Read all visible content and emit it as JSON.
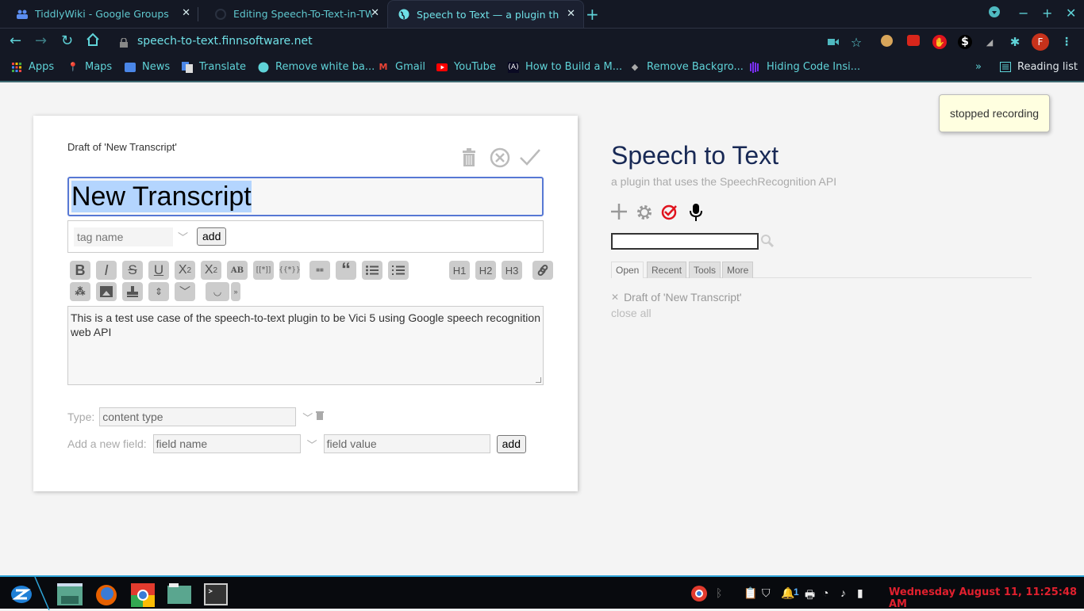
{
  "browser": {
    "tabs": [
      {
        "label": "TiddlyWiki - Google Groups",
        "icon": "google-groups-icon",
        "active": false
      },
      {
        "label": "Editing Speech-To-Text-in-TW",
        "icon": "github-icon",
        "active": false
      },
      {
        "label": "Speech to Text — a plugin tha",
        "icon": "globe-icon",
        "active": true
      }
    ],
    "url": "speech-to-text.finnsoftware.net",
    "profile_initial": "F",
    "reading_list_label": "Reading list",
    "bookmarks": [
      {
        "label": "Apps",
        "icon": "apps-grid-icon"
      },
      {
        "label": "Maps",
        "icon": "maps-pin-icon"
      },
      {
        "label": "News",
        "icon": "news-icon"
      },
      {
        "label": "Translate",
        "icon": "translate-icon"
      },
      {
        "label": "Remove white ba...",
        "icon": "globe-icon"
      },
      {
        "label": "Gmail",
        "icon": "gmail-icon"
      },
      {
        "label": "YouTube",
        "icon": "youtube-icon"
      },
      {
        "label": "How to Build a M...",
        "icon": "freecodecamp-icon"
      },
      {
        "label": "Remove Backgro...",
        "icon": "layers-icon"
      },
      {
        "label": "Hiding Code Insi...",
        "icon": "bars-icon"
      }
    ]
  },
  "editor": {
    "draft_heading": "Draft of 'New Transcript'",
    "title_value": "New Transcript",
    "tag_placeholder": "tag name",
    "add_label": "add",
    "toolbar": [
      "bold",
      "italic",
      "strikethrough",
      "underline",
      "superscript",
      "subscript",
      "smallcaps",
      "wikilink",
      "transclude",
      "monospaced",
      "quote",
      "bulleted-list",
      "numbered-list",
      "heading-1",
      "heading-2",
      "heading-3",
      "link",
      "excise",
      "picture",
      "stamp",
      "size",
      "more",
      "preview",
      "preview-type"
    ],
    "toolbar_labels": {
      "h1": "H1",
      "h2": "H2",
      "h3": "H3",
      "sup": "X",
      "sub": "X",
      "ab": "AB",
      "wikilink": "[[*]]",
      "transclude": "{{*}}"
    },
    "body_text": "This is a test use case of the speech-to-text plugin to be Vici 5 using Google speech recognition web API",
    "type_label": "Type:",
    "type_placeholder": "content type",
    "new_field_label": "Add a new field:",
    "field_name_placeholder": "field name",
    "field_value_placeholder": "field value"
  },
  "sidebar": {
    "title": "Speech to Text",
    "subtitle": "a plugin that uses the SpeechRecognition API",
    "tabs": [
      {
        "label": "Open",
        "active": true
      },
      {
        "label": "Recent",
        "active": false
      },
      {
        "label": "Tools",
        "active": false
      },
      {
        "label": "More",
        "active": false
      }
    ],
    "open_items": [
      "Draft of 'New Transcript'"
    ],
    "close_all_label": "close all"
  },
  "notification": "stopped recording",
  "taskbar": {
    "clock": "Wednesday August 11, 11:25:48 AM",
    "notification_count": "1",
    "accent_color": "#e0202e"
  }
}
